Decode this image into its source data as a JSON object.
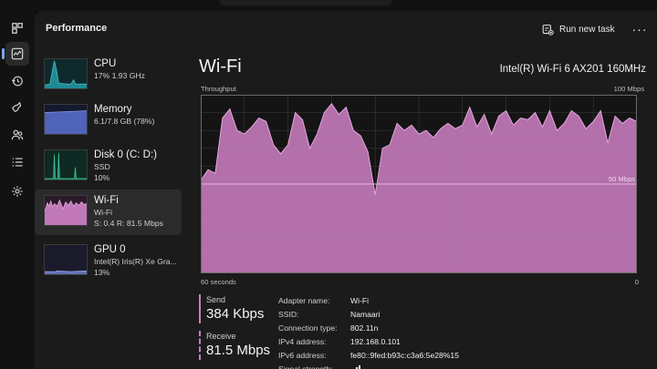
{
  "window": {
    "title": "Performance"
  },
  "toolbar": {
    "run_task_label": "Run new task",
    "more_icon": "more-icon"
  },
  "nav_icons": [
    "processes-icon",
    "performance-icon",
    "app-history-icon",
    "startup-apps-icon",
    "users-icon",
    "details-icon",
    "services-icon"
  ],
  "devices": [
    {
      "name": "CPU",
      "line1": "17% 1.93 GHz",
      "line2": ""
    },
    {
      "name": "Memory",
      "line1": "6.1/7.8 GB (78%)",
      "line2": ""
    },
    {
      "name": "Disk 0 (C: D:)",
      "line1": "SSD",
      "line2": "10%"
    },
    {
      "name": "Wi-Fi",
      "line1": "Wi-Fi",
      "line2": "S: 0.4  R: 81.5 Mbps"
    },
    {
      "name": "GPU 0",
      "line1": "Intel(R) Iris(R) Xe Gra...",
      "line2": "13%"
    }
  ],
  "detail": {
    "title": "Wi-Fi",
    "adapter": "Intel(R) Wi-Fi 6 AX201 160MHz",
    "y_label": "Throughput",
    "y_max_label": "100 Mbps",
    "mid_label": "50 Mbps",
    "x_left_label": "60 seconds",
    "x_right_label": "0"
  },
  "chart_data": {
    "type": "area",
    "x": [
      60,
      59,
      58,
      57,
      56,
      55,
      54,
      53,
      52,
      51,
      50,
      49,
      48,
      47,
      46,
      45,
      44,
      43,
      42,
      41,
      40,
      39,
      38,
      37,
      36,
      35,
      34,
      33,
      32,
      31,
      30,
      29,
      28,
      27,
      26,
      25,
      24,
      23,
      22,
      21,
      20,
      19,
      18,
      17,
      16,
      15,
      14,
      13,
      12,
      11,
      10,
      9,
      8,
      7,
      6,
      5,
      4,
      3,
      2,
      1,
      0
    ],
    "series": [
      {
        "values": [
          52,
          58,
          56,
          87,
          92,
          80,
          78,
          82,
          87,
          85,
          72,
          67,
          72,
          90,
          86,
          70,
          78,
          90,
          95,
          89,
          93,
          80,
          77,
          68,
          44,
          70,
          72,
          84,
          80,
          83,
          78,
          80,
          76,
          81,
          84,
          81,
          83,
          93,
          82,
          89,
          78,
          88,
          91,
          83,
          87,
          86,
          90,
          82,
          91,
          80,
          84,
          91,
          88,
          81,
          85,
          91,
          73,
          88,
          84,
          87,
          85
        ]
      }
    ],
    "ylim": [
      0,
      100
    ],
    "xlim": [
      60,
      0
    ],
    "reference_line": 50,
    "colors": {
      "fill": "#c178b9",
      "line": "#e4a6dd",
      "grid": "#5a5a5a",
      "background": "#141414"
    }
  },
  "stats": {
    "send_label": "Send",
    "send_value": "384 Kbps",
    "receive_label": "Receive",
    "receive_value": "81.5 Mbps"
  },
  "properties": [
    {
      "key": "Adapter name:",
      "value": "Wi-Fi"
    },
    {
      "key": "SSID:",
      "value": "Namaari"
    },
    {
      "key": "Connection type:",
      "value": "802.11n"
    },
    {
      "key": "IPv4 address:",
      "value": "192.168.0.101"
    },
    {
      "key": "IPv6 address:",
      "value": "fe80::9fed:b93c:c3a6:5e28%15"
    },
    {
      "key": "Signal strength:",
      "value": ""
    }
  ]
}
